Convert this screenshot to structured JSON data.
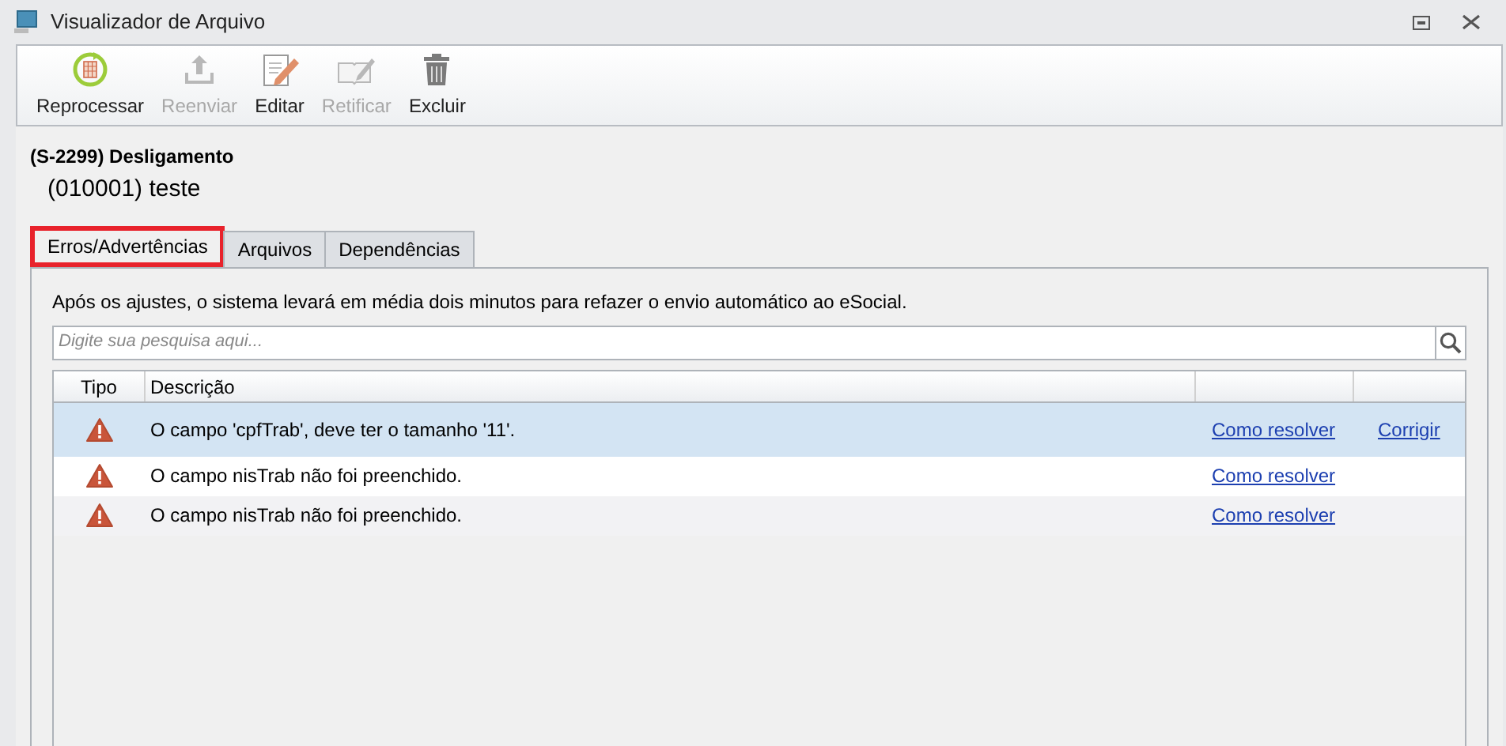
{
  "window": {
    "title": "Visualizador de Arquivo"
  },
  "toolbar": [
    {
      "kind": "reprocess",
      "label": "Reprocessar",
      "disabled": false
    },
    {
      "kind": "upload",
      "label": "Reenviar",
      "disabled": true
    },
    {
      "kind": "edit",
      "label": "Editar",
      "disabled": false
    },
    {
      "kind": "rectify",
      "label": "Retificar",
      "disabled": true
    },
    {
      "kind": "delete",
      "label": "Excluir",
      "disabled": false
    }
  ],
  "event": {
    "title": "(S-2299) Desligamento",
    "subtitle": "(010001) teste"
  },
  "tabs": [
    {
      "label": "Erros/Advertências",
      "selected": true,
      "highlighted": true
    },
    {
      "label": "Arquivos",
      "selected": false,
      "highlighted": false
    },
    {
      "label": "Dependências",
      "selected": false,
      "highlighted": false
    }
  ],
  "notice": "Após os ajustes, o sistema levará em média dois minutos para refazer o envio automático ao eSocial.",
  "search": {
    "placeholder": "Digite sua pesquisa aqui..."
  },
  "table": {
    "columns": [
      "Tipo",
      "Descrição"
    ],
    "rows": [
      {
        "description": "O campo 'cpfTrab', deve ter o tamanho '11'.",
        "help": "Como resolver",
        "fix": "Corrigir",
        "selected": true
      },
      {
        "description": "O campo nisTrab não foi preenchido.",
        "help": "Como resolver",
        "selected": false
      },
      {
        "description": "O campo nisTrab não foi preenchido.",
        "help": "Como resolver",
        "selected": false
      }
    ]
  }
}
